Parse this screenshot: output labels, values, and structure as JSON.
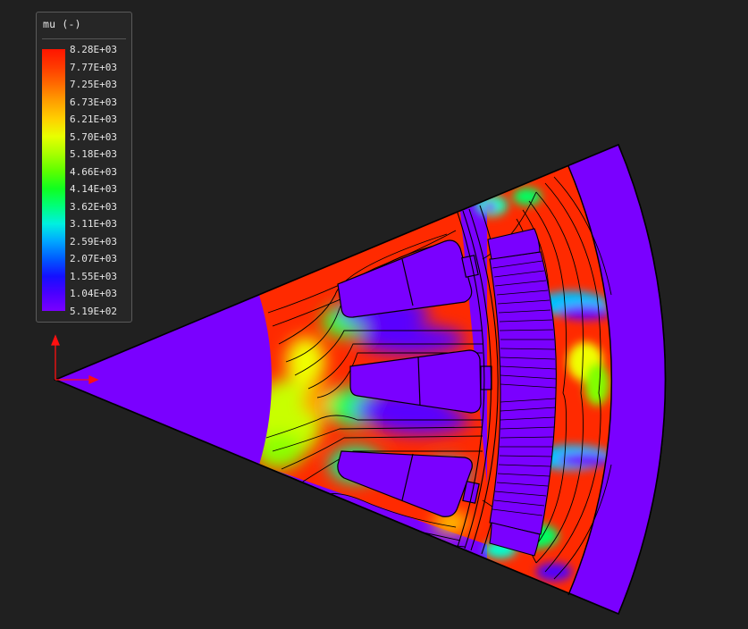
{
  "legend": {
    "title": "mu (-)",
    "ticks": [
      "8.28E+03",
      "7.77E+03",
      "7.25E+03",
      "6.73E+03",
      "6.21E+03",
      "5.70E+03",
      "5.18E+03",
      "4.66E+03",
      "4.14E+03",
      "3.62E+03",
      "3.11E+03",
      "2.59E+03",
      "2.07E+03",
      "1.55E+03",
      "1.04E+03",
      "5.19E+02"
    ],
    "colors": [
      "#ff1500",
      "#ff3a00",
      "#ff6a00",
      "#ffa000",
      "#ffd000",
      "#e8ff00",
      "#a8ff00",
      "#5cff00",
      "#10ff20",
      "#00ff7a",
      "#00f0e0",
      "#00a8ff",
      "#005cff",
      "#1410ff",
      "#4a00ff",
      "#7a00ff"
    ]
  },
  "colors": {
    "background": "#202020",
    "low": "#7a00ff",
    "high": "#ff2a00",
    "axis": "#ff1010",
    "outline": "#000000"
  }
}
